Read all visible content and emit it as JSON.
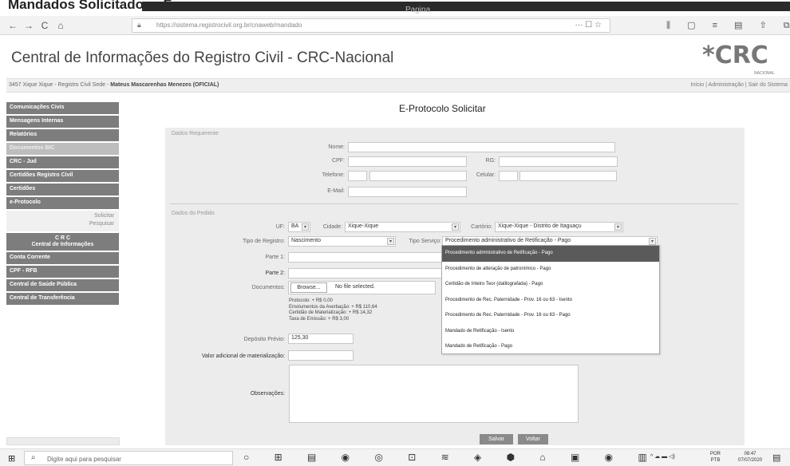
{
  "caption": {
    "text": "Mandados Solicitados - Fazer",
    "tab": "Pagina"
  },
  "browser": {
    "url": "https://sistema.registrocivil.org.br/cnaweb/mandado",
    "nav_icons": [
      "←",
      "→",
      "C",
      "⌂"
    ],
    "url_icons": "··· ☐ ☆",
    "toolbar_icons": "⫼ ▢ ≡ ▤ ⇧ ⧉ ≡"
  },
  "site": {
    "title": "Central de Informações do Registro Civil - CRC-Nacional",
    "logo": "*CRC",
    "logo_sub": "NACIONAL",
    "user_info": "3457 Xique Xique - Registro Civil Sede - ",
    "user_name": "Mateus Mascarenhas Menezes (OFICIAL)",
    "top_links": "Início | Administração | Sair do Sistema"
  },
  "sidebar": {
    "items": [
      "Comunicações Civis",
      "Mensagens Internas",
      "Relatórios",
      "Documentos BIC",
      "CRC - Jud",
      "Certidões Registro Civil",
      "Certidões",
      "e-Protocolo"
    ],
    "sub_items": [
      "Solicitar",
      "Pesquisar"
    ],
    "items_after": [
      "C R C",
      "Central de Informações",
      "Conta Corrente",
      "CPF - RFB",
      "Central de Saúde Pública",
      "Central de Transferência"
    ]
  },
  "page": {
    "title": "E-Protocolo Solicitar",
    "section_requerente": "Dados Requerente",
    "section_pedido": "Dados do Pedido",
    "labels": {
      "nome": "Nome:",
      "cpf": "CPF:",
      "rg": "RG:",
      "telefone": "Telefone:",
      "celular": "Celular:",
      "email": "E-Mail:",
      "uf": "UF:",
      "cidade": "Cidade:",
      "cartorio": "Cartório:",
      "tipo_registro": "Tipo de Registro:",
      "tipo_servico": "Tipo Serviço:",
      "parte1": "Parte 1:",
      "parte2": "Parte 2:",
      "documentos": "Documentos:",
      "deposito": "Depósito Prévio:",
      "valor_adicional": "Valor adicional de materialização:",
      "observacoes": "Observações:"
    },
    "values": {
      "uf": "BA",
      "cidade": "Xique-Xique",
      "cartorio": "Xique-Xique - Distrito de Itaguaçu",
      "tipo_registro": "Nascimento",
      "tipo_servico": "Procedimento administrativo de Retificação - Pago",
      "deposito": "125,30",
      "file_button": "Browse...",
      "file_status": "No file selected."
    },
    "fees": "Protocolo: + R$ 0,00\nEmolumentos da Averbação: + R$ 110,64\nCertidão de Materialização: + R$ 14,32\nTaxa de Emissão: + R$ 3,00",
    "buttons": {
      "salvar": "Salvar",
      "voltar": "Voltar"
    },
    "service_options": [
      "Procedimento administrativo de Retificação - Pago",
      "Procedimento de alteração de patronímico - Pago",
      "Certidão de Inteiro Teor (datilografada) - Pago",
      "Procedimento de Rec. Paternidade - Prov. 16 ou 63 - Isento",
      "Procedimento de Rec. Paternidade - Prov. 16 ou 63 - Pago",
      "Mandado de Retificação - Isento",
      "Mandado de Retificação - Pago"
    ]
  },
  "taskbar": {
    "search_placeholder": "Digite aqui para pesquisar",
    "language": "POR",
    "language_sub": "PTB",
    "time": "08:47",
    "date": "07/07/2020",
    "icons": "○ ⊞ ▤ ◉ ◎ ⊡ ≋ ◈ ⬢ ⌂ ▣ ◉ ▥"
  },
  "colors": {
    "sidebar_bg": "#7d7d7d",
    "dropdown_highlight": "#5a5a5a",
    "panel_bg": "#ececec"
  }
}
